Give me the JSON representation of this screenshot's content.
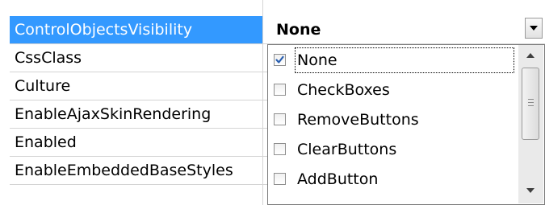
{
  "properties": [
    {
      "name": "ControlObjectsVisibility",
      "value": "None",
      "selected": true
    },
    {
      "name": "CssClass",
      "value": ""
    },
    {
      "name": "Culture",
      "value": ""
    },
    {
      "name": "EnableAjaxSkinRendering",
      "value": ""
    },
    {
      "name": "Enabled",
      "value": ""
    },
    {
      "name": "EnableEmbeddedBaseStyles",
      "value": ""
    }
  ],
  "dropdown": {
    "options": [
      {
        "label": "None",
        "checked": true
      },
      {
        "label": "CheckBoxes",
        "checked": false
      },
      {
        "label": "RemoveButtons",
        "checked": false
      },
      {
        "label": "ClearButtons",
        "checked": false
      },
      {
        "label": "AddButton",
        "checked": false
      }
    ]
  },
  "colors": {
    "selection": "#3399ff",
    "check": "#2a5fb0"
  },
  "icons": {
    "dropdown_button": "chevron-down-icon",
    "scroll_up": "triangle-up-icon",
    "scroll_down": "triangle-down-icon",
    "checkmark": "checkmark-icon"
  }
}
